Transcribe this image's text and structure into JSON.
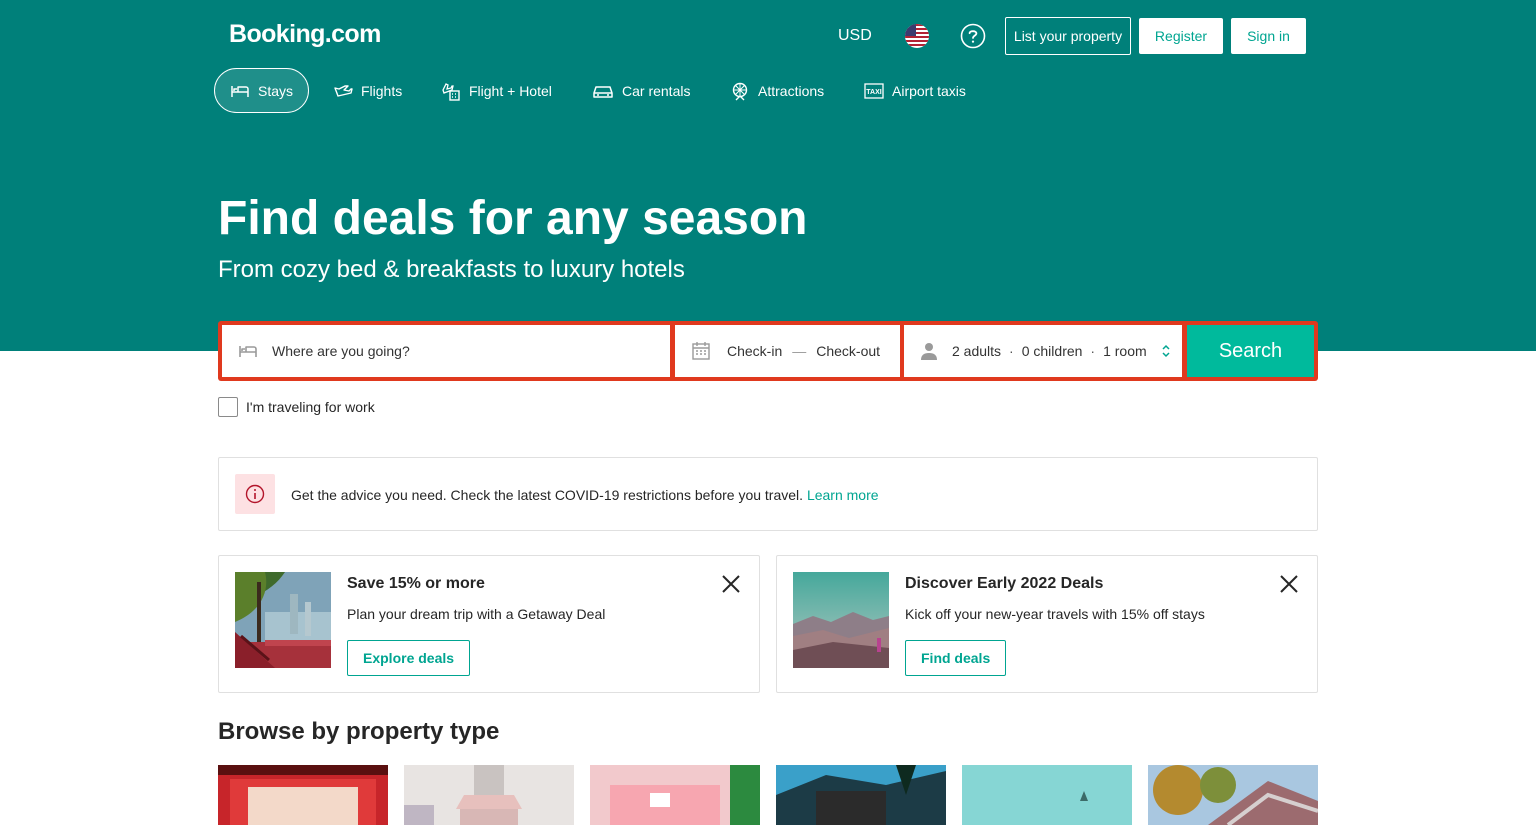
{
  "header": {
    "logo": "Booking.com",
    "currency": "USD",
    "flag_icon": "us-flag-icon",
    "help_icon": "question-circle-icon",
    "list_property": "List your property",
    "register": "Register",
    "sign_in": "Sign in"
  },
  "nav": {
    "items": [
      {
        "label": "Stays",
        "icon": "bed-icon",
        "active": true
      },
      {
        "label": "Flights",
        "icon": "plane-icon",
        "active": false
      },
      {
        "label": "Flight + Hotel",
        "icon": "flight-hotel-icon",
        "active": false
      },
      {
        "label": "Car rentals",
        "icon": "car-icon",
        "active": false
      },
      {
        "label": "Attractions",
        "icon": "attractions-icon",
        "active": false
      },
      {
        "label": "Airport taxis",
        "icon": "taxi-icon",
        "active": false
      }
    ]
  },
  "hero": {
    "title": "Find deals for any season",
    "subtitle": "From cozy bed & breakfasts to luxury hotels"
  },
  "search": {
    "destination_placeholder": "Where are you going?",
    "check_in": "Check-in",
    "check_out": "Check-out",
    "adults": "2 adults",
    "children": "0 children",
    "rooms": "1 room",
    "button": "Search",
    "work_label": "I'm traveling for work",
    "accent_color": "#e0391e"
  },
  "covid": {
    "text": "Get the advice you need. Check the latest COVID-19 restrictions before you travel.",
    "link": "Learn more",
    "icon": "info-circle-icon"
  },
  "promos": [
    {
      "title": "Save 15% or more",
      "desc": "Plan your dream trip with a Getaway Deal",
      "button": "Explore deals"
    },
    {
      "title": "Discover Early 2022 Deals",
      "desc": "Kick off your new-year travels with 15% off stays",
      "button": "Find deals"
    }
  ],
  "browse": {
    "title": "Browse by property type"
  },
  "colors": {
    "brand": "#00807a",
    "accent": "#00a591",
    "search_button": "#00ba9c"
  }
}
